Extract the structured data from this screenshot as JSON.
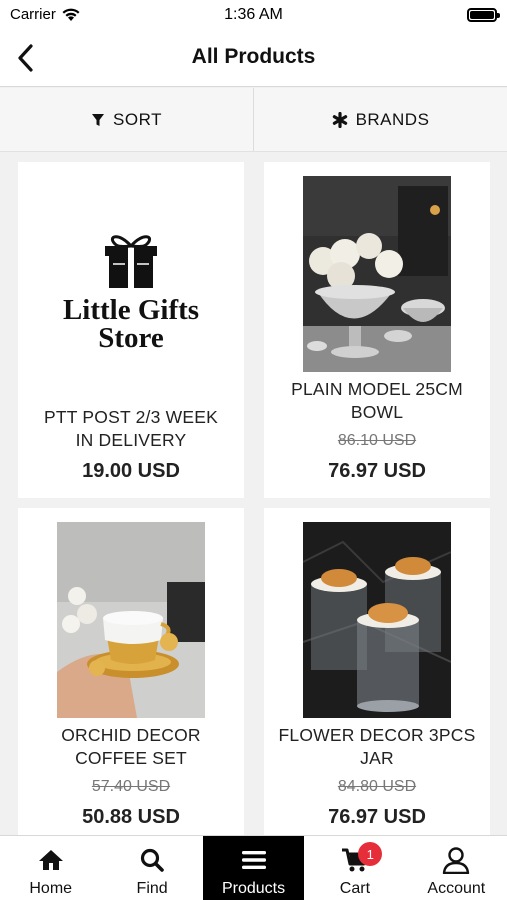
{
  "status": {
    "carrier": "Carrier",
    "time": "1:36 AM"
  },
  "nav": {
    "title": "All Products"
  },
  "filters": {
    "sort_label": "SORT",
    "brands_label": "BRANDS"
  },
  "products": [
    {
      "name_line1": "PTT POST 2/3 WEEK",
      "name_line2": "IN DELIVERY",
      "old_price": "",
      "price": "19.00 USD",
      "logo_line1": "Little Gifts",
      "logo_line2": "Store"
    },
    {
      "name_line1": "PLAIN MODEL 25CM",
      "name_line2": "BOWL",
      "old_price": "86.10 USD",
      "price": "76.97 USD"
    },
    {
      "name_line1": "ORCHID DECOR",
      "name_line2": "COFFEE SET",
      "old_price": "57.40 USD",
      "price": "50.88 USD"
    },
    {
      "name_line1": "FLOWER DECOR 3PCS",
      "name_line2": "JAR",
      "old_price": "84.80 USD",
      "price": "76.97 USD"
    }
  ],
  "tabs": [
    {
      "label": "Home",
      "icon": "home-icon"
    },
    {
      "label": "Find",
      "icon": "search-icon"
    },
    {
      "label": "Products",
      "icon": "menu-icon"
    },
    {
      "label": "Cart",
      "icon": "cart-icon",
      "badge": "1"
    },
    {
      "label": "Account",
      "icon": "user-icon"
    }
  ],
  "colors": {
    "accent": "#000000",
    "badge": "#e62e3b"
  }
}
